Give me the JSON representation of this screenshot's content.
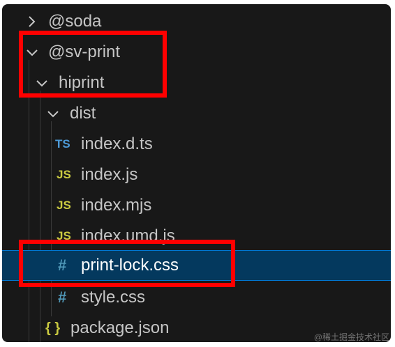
{
  "explorer": {
    "items": [
      {
        "label": "@soda",
        "kind": "folder",
        "expanded": false,
        "icon": "chevron-right-icon"
      },
      {
        "label": "@sv-print",
        "kind": "folder",
        "expanded": true,
        "icon": "chevron-down-icon"
      },
      {
        "label": "hiprint",
        "kind": "folder",
        "expanded": true,
        "icon": "chevron-down-icon"
      },
      {
        "label": "dist",
        "kind": "folder",
        "expanded": true,
        "icon": "chevron-down-icon"
      },
      {
        "label": "index.d.ts",
        "kind": "file",
        "badge": "TS",
        "icon": "typescript-file-icon"
      },
      {
        "label": "index.js",
        "kind": "file",
        "badge": "JS",
        "icon": "javascript-file-icon"
      },
      {
        "label": "index.mjs",
        "kind": "file",
        "badge": "JS",
        "icon": "javascript-file-icon"
      },
      {
        "label": "index.umd.js",
        "kind": "file",
        "badge": "JS",
        "icon": "javascript-file-icon"
      },
      {
        "label": "print-lock.css",
        "kind": "file",
        "badge": "#",
        "icon": "css-file-icon",
        "selected": true
      },
      {
        "label": "style.css",
        "kind": "file",
        "badge": "#",
        "icon": "css-file-icon"
      },
      {
        "label": "package.json",
        "kind": "file",
        "badge": "{ }",
        "icon": "json-file-icon"
      }
    ]
  },
  "watermark": "@稀土掘金技术社区",
  "colors": {
    "background": "#181818",
    "text": "#c5c5c5",
    "selection": "#04395e",
    "focus_border": "#0078d4",
    "highlight_box": "#ff0000",
    "ts_badge": "#4d9ad6",
    "js_badge": "#cbcb41",
    "css_badge": "#519aba"
  }
}
